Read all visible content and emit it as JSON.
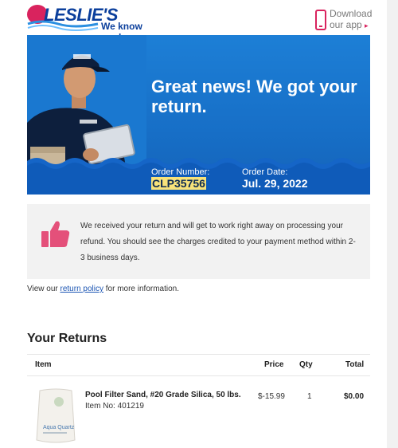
{
  "brand": {
    "logo_text": "LESLIE'S",
    "tagline": "We know pools.",
    "colors": {
      "navy": "#0b3f9c",
      "accent": "#d9235e",
      "hero_blue": "#176fc7"
    }
  },
  "app_promo": {
    "line1": "Download",
    "line2": "our app",
    "arrow": "▸",
    "icon": "mobile-phone-icon"
  },
  "hero": {
    "title": "Great news! We got your return.",
    "order_number_label": "Order Number:",
    "order_number": "CLP35756",
    "order_date_label": "Order Date:",
    "order_date": "Jul. 29, 2022"
  },
  "notice": {
    "icon": "thumbs-up-icon",
    "text": "We received your return and will get to work right away on processing your refund. You should see the charges credited to your payment method within 2-3 business days."
  },
  "policy": {
    "prefix": "View our ",
    "link_text": "return policy",
    "suffix": " for more information."
  },
  "returns": {
    "title": "Your Returns",
    "columns": {
      "item": "Item",
      "price": "Price",
      "qty": "Qty",
      "total": "Total"
    },
    "items": [
      {
        "name": "Pool Filter Sand, #20 Grade Silica, 50 lbs.",
        "item_no": "Item No: 401219",
        "price": "$-15.99",
        "qty": "1",
        "total": "$0.00",
        "bag_label": "Aqua Quartz"
      }
    ]
  }
}
